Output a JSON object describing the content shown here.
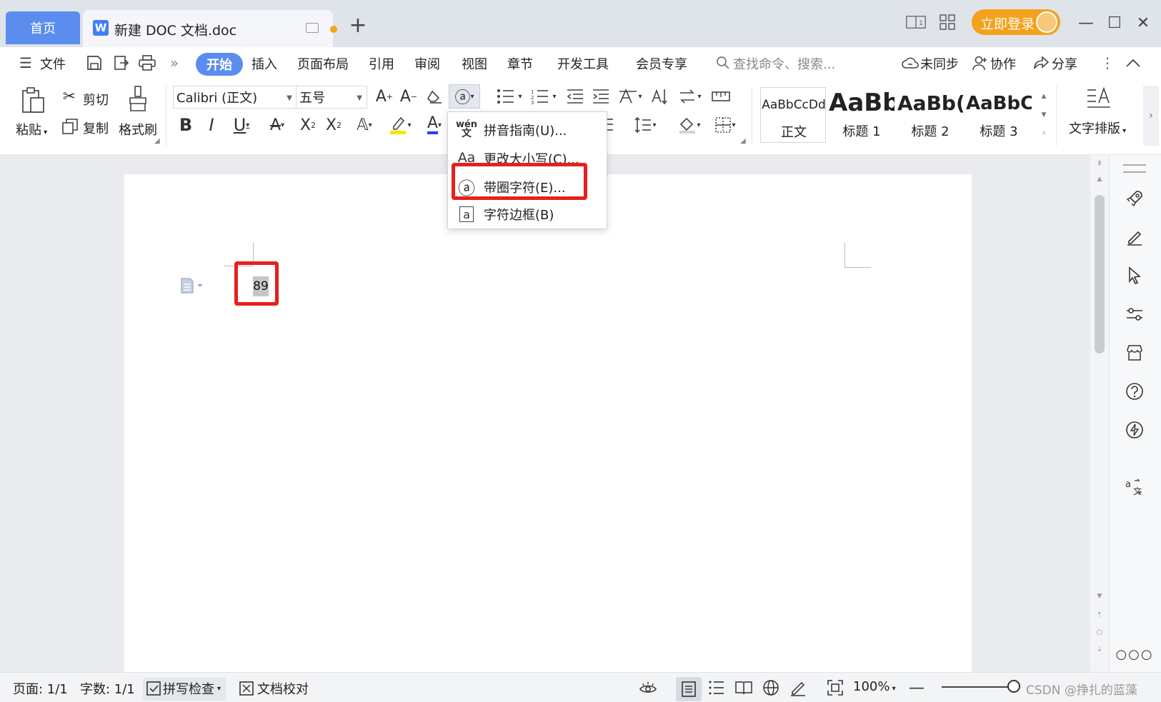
{
  "titlebar": {
    "home_tab": "首页",
    "doc_tab_title": "新建 DOC 文档.doc",
    "login_label": "立即登录"
  },
  "menubar": {
    "file": "文件",
    "start": "开始",
    "insert": "插入",
    "page_layout": "页面布局",
    "references": "引用",
    "review": "审阅",
    "view": "视图",
    "chapter": "章节",
    "developer": "开发工具",
    "member": "会员专享",
    "search_placeholder": "查找命令、搜索...",
    "sync": "未同步",
    "collab": "协作",
    "share": "分享"
  },
  "ribbon": {
    "paste": "粘贴",
    "cut": "剪切",
    "copy": "复制",
    "format_painter": "格式刷",
    "font_name": "Calibri (正文)",
    "font_size": "五号",
    "styles": [
      {
        "preview": "AaBbCcDd",
        "label": "正文"
      },
      {
        "preview": "AaBb",
        "label": "标题 1"
      },
      {
        "preview": "AaBb(",
        "label": "标题 2"
      },
      {
        "preview": "AaBbC",
        "label": "标题 3"
      }
    ],
    "text_layout": "文字排版"
  },
  "dropdown": {
    "items": [
      {
        "icon": "wén",
        "label": "拼音指南(U)..."
      },
      {
        "icon": "Aa",
        "label": "更改大小写(C)..."
      },
      {
        "icon": "ⓐ",
        "label": "带圈字符(E)..."
      },
      {
        "icon": "a",
        "label": "字符边框(B)"
      }
    ]
  },
  "document": {
    "text": "89"
  },
  "statusbar": {
    "page": "页面: 1/1",
    "words": "字数: 1/1",
    "spell_check": "拼写检查",
    "doc_compare": "文档校对",
    "zoom": "100%",
    "watermark": "CSDN @挣扎的蓝藻"
  },
  "colors": {
    "accent_blue": "#5b8def",
    "login_orange": "#f4a11b",
    "highlight_red": "#e8201c"
  }
}
